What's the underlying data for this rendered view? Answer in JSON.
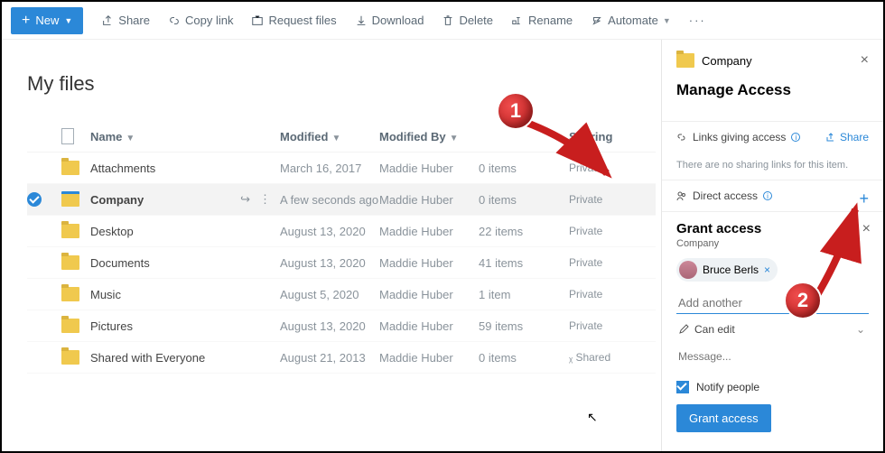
{
  "toolbar": {
    "new_label": "New",
    "items": [
      {
        "label": "Share",
        "icon": "share-icon"
      },
      {
        "label": "Copy link",
        "icon": "link-icon"
      },
      {
        "label": "Request files",
        "icon": "request-icon"
      },
      {
        "label": "Download",
        "icon": "download-icon"
      },
      {
        "label": "Delete",
        "icon": "delete-icon"
      },
      {
        "label": "Rename",
        "icon": "rename-icon"
      },
      {
        "label": "Automate",
        "icon": "automate-icon"
      }
    ]
  },
  "heading": "My files",
  "columns": {
    "name": "Name",
    "modified": "Modified",
    "modified_by": "Modified By",
    "file_size": " ",
    "sharing": "Sharing"
  },
  "rows": [
    {
      "name": "Attachments",
      "modified": "March 16, 2017",
      "by": "Maddie Huber",
      "size": "0 items",
      "sharing": "Private",
      "selected": false
    },
    {
      "name": "Company",
      "modified": "A few seconds ago",
      "by": "Maddie Huber",
      "size": "0 items",
      "sharing": "Private",
      "selected": true
    },
    {
      "name": "Desktop",
      "modified": "August 13, 2020",
      "by": "Maddie Huber",
      "size": "22 items",
      "sharing": "Private",
      "selected": false
    },
    {
      "name": "Documents",
      "modified": "August 13, 2020",
      "by": "Maddie Huber",
      "size": "41 items",
      "sharing": "Private",
      "selected": false
    },
    {
      "name": "Music",
      "modified": "August 5, 2020",
      "by": "Maddie Huber",
      "size": "1 item",
      "sharing": "Private",
      "selected": false
    },
    {
      "name": "Pictures",
      "modified": "August 13, 2020",
      "by": "Maddie Huber",
      "size": "59 items",
      "sharing": "Private",
      "selected": false
    },
    {
      "name": "Shared with Everyone",
      "modified": "August 21, 2013",
      "by": "Maddie Huber",
      "size": "0 items",
      "sharing": "ᵪ Shared",
      "selected": false
    }
  ],
  "side": {
    "folder_name": "Company",
    "title": "Manage Access",
    "links_label": "Links giving access",
    "share_label": "Share",
    "no_links_msg": "There are no sharing links for this item.",
    "direct_label": "Direct access",
    "grant": {
      "heading": "Grant access",
      "subtitle": "Company",
      "chip_name": "Bruce Berls",
      "add_placeholder": "Add another",
      "perm": "Can edit",
      "msg_placeholder": "Message...",
      "notify": "Notify people",
      "button": "Grant access"
    }
  },
  "callouts": {
    "one": "1",
    "two": "2"
  }
}
